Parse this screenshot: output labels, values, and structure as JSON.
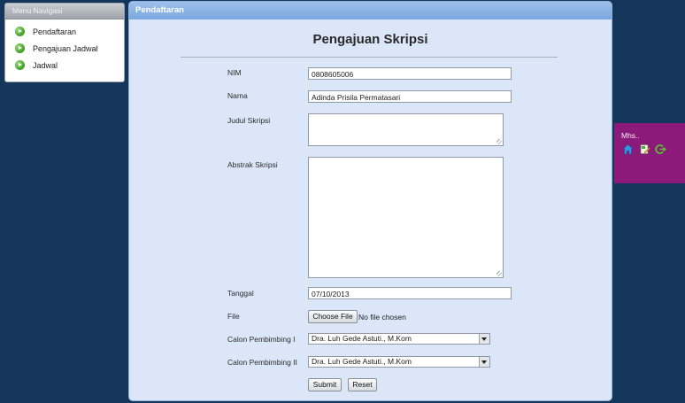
{
  "nav": {
    "title": "Menu Navigasi",
    "items": [
      {
        "label": "Pendaftaran"
      },
      {
        "label": "Pengajuan Jadwal"
      },
      {
        "label": "Jadwal"
      }
    ]
  },
  "panel": {
    "header": "Pendaftaran",
    "form_title": "Pengajuan Skripsi"
  },
  "form": {
    "nim": {
      "label": "NIM",
      "value": "0808605006"
    },
    "nama": {
      "label": "Nama",
      "value": "Adinda Prisila Permatasari"
    },
    "judul": {
      "label": "Judul Skripsi",
      "value": ""
    },
    "abstrak": {
      "label": "Abstrak Skripsi",
      "value": ""
    },
    "tanggal": {
      "label": "Tanggal",
      "value": "07/10/2013"
    },
    "file": {
      "label": "File",
      "button": "Choose File",
      "status": "No file chosen"
    },
    "pembimbing1": {
      "label": "Calon Pembimbing I",
      "value": "Dra. Luh Gede Astuti., M.Kom"
    },
    "pembimbing2": {
      "label": "Calon Pembimbing II",
      "value": "Dra. Luh Gede Astuti., M.Kom"
    },
    "submit": "Submit",
    "reset": "Reset"
  },
  "userbox": {
    "label": "Mhs..",
    "icons": [
      "home-icon",
      "edit-profile-icon",
      "logout-icon"
    ]
  },
  "colors": {
    "background": "#14365a",
    "panel": "#dbe6f8",
    "panel_header": "#7aa8df",
    "userbox": "#8b1a7a",
    "nav_bullet": "#3c9a22"
  }
}
